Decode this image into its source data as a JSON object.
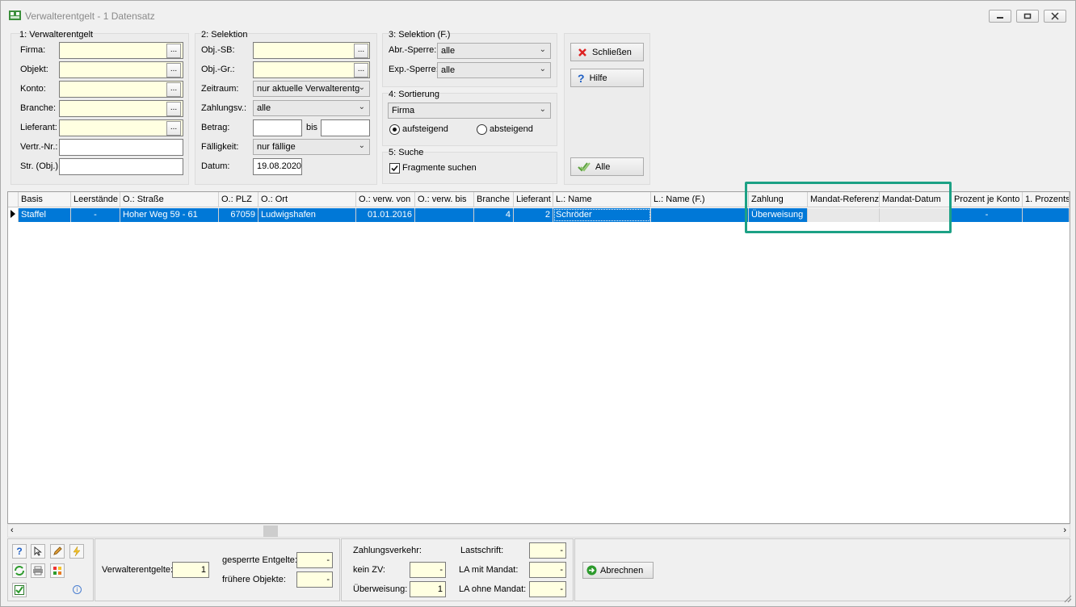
{
  "window": {
    "title": "Verwalterentgelt - 1 Datensatz"
  },
  "group1": {
    "legend": "1: Verwalterentgelt",
    "labels": [
      "Firma:",
      "Objekt:",
      "Konto:",
      "Branche:",
      "Lieferant:",
      "Vertr.-Nr.:",
      "Str. (Obj.):"
    ],
    "dots": "..."
  },
  "group2": {
    "legend": "2: Selektion",
    "labels": [
      "Obj.-SB:",
      "Obj.-Gr.:",
      "Zeitraum:",
      "Zahlungsv.:",
      "Betrag:",
      "Fälligkeit:",
      "Datum:"
    ],
    "zeitraum": "nur aktuelle Verwalterentg",
    "zahlungsv": "alle",
    "bis": "bis",
    "faelligkeit": "nur fällige",
    "datum": "19.08.2020"
  },
  "group3": {
    "legend": "3: Selektion (F.)",
    "abr_label": "Abr.-Sperre:",
    "abr_value": "alle",
    "exp_label": "Exp.-Sperre:",
    "exp_value": "alle"
  },
  "group4": {
    "legend": "4: Sortierung",
    "sort_value": "Firma",
    "asc": "aufsteigend",
    "desc": "absteigend"
  },
  "group5": {
    "legend": "5: Suche",
    "fragmente": "Fragmente suchen"
  },
  "buttons": {
    "close": "Schließen",
    "help": "Hilfe",
    "all": "Alle",
    "calc": "Abrechnen"
  },
  "table": {
    "columns": [
      "Basis",
      "Leerstände",
      "O.: Straße",
      "O.: PLZ",
      "O.: Ort",
      "O.: verw. von",
      "O.: verw. bis",
      "Branche",
      "Lieferant",
      "L.: Name",
      "L.: Name (F.)",
      "Zahlung",
      "Mandat-Referenz",
      "Mandat-Datum",
      "Prozent je Konto",
      "1. Prozents"
    ],
    "row": [
      "Staffel",
      "-",
      "Hoher Weg 59 - 61",
      "67059",
      "Ludwigshafen",
      "01.01.2016",
      "",
      "4",
      "2",
      "Schröder",
      "",
      "Überweisung",
      "",
      "",
      "-",
      ""
    ]
  },
  "footer": {
    "verwalterentgelte_label": "Verwalterentgelte:",
    "verwalterentgelte_value": "1",
    "gesperrte_label": "gesperrte Entgelte:",
    "gesperrte_value": "-",
    "fruehere_label": "frühere Objekte:",
    "fruehere_value": "-",
    "zv_label": "Zahlungsverkehr:",
    "keinzv_label": "kein ZV:",
    "keinzv_value": "-",
    "ueberweisung_label": "Überweisung:",
    "ueberweisung_value": "1",
    "lastschrift_label": "Lastschrift:",
    "lastschrift_value": "-",
    "lamit_label": "LA mit Mandat:",
    "lamit_value": "-",
    "laohne_label": "LA ohne Mandat:",
    "laohne_value": "-"
  }
}
